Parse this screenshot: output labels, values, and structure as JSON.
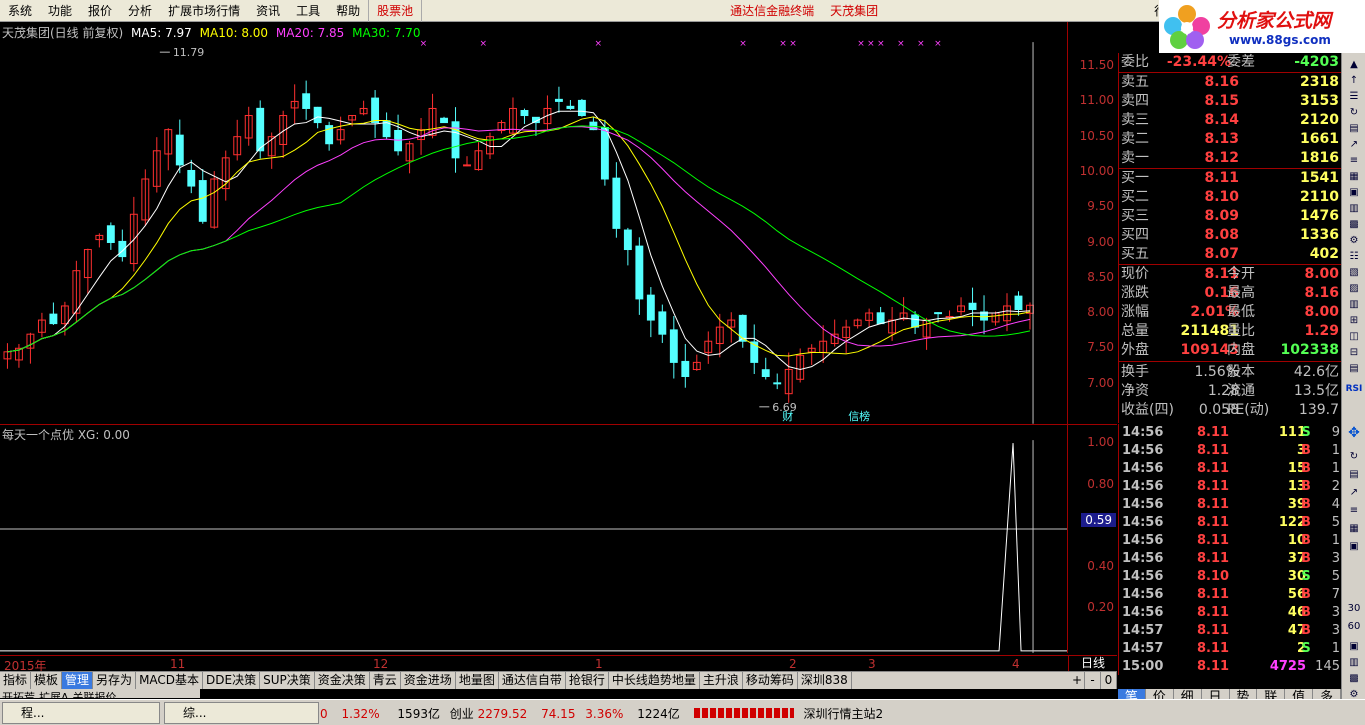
{
  "menu": {
    "items": [
      "系统",
      "功能",
      "报价",
      "分析",
      "扩展市场行情",
      "资讯",
      "工具",
      "帮助"
    ],
    "stock_pool": "股票池",
    "center_title": "通达信金融终端",
    "stock_name": "天茂集团",
    "corner_label": "行"
  },
  "promo": {
    "site_name": "分析家公式网",
    "url": "www.88gs.com"
  },
  "chart_title": {
    "name": "天茂集团(日线 前复权)",
    "ma5": "MA5: 7.97",
    "ma10": "MA10: 8.00",
    "ma20": "MA20: 7.85",
    "ma30": "MA30: 7.70"
  },
  "indicator_title": "每天一个点优  XG: 0.00",
  "indicator_axis": [
    "1.00",
    "0.80",
    "0.59",
    "0.40",
    "0.20"
  ],
  "price_axis": [
    "11.50",
    "11.00",
    "10.50",
    "10.00",
    "9.50",
    "9.00",
    "8.50",
    "8.00",
    "7.50",
    "7.00"
  ],
  "date_axis": [
    "2015年",
    "11",
    "12",
    "1",
    "2",
    "3",
    "4"
  ],
  "date_axis_right": "日线",
  "annotations": {
    "high": "11.79",
    "low": "6.69",
    "cai": "财",
    "xinbang": "信榜"
  },
  "tabs": [
    "指标",
    "模板",
    "管理",
    "另存为",
    "MACD基本",
    "DDE决策",
    "SUP决策",
    "资金决策",
    "青云",
    "资金进场",
    "地量图",
    "通达信自带",
    "抢银行",
    "中长线趋势地量",
    "主升浪",
    "移动筹码",
    "深圳838"
  ],
  "tabs_active": 2,
  "tabs_controls": [
    "+",
    "-",
    "0"
  ],
  "tabs_row2": [
    "开拓荒",
    "扩展A",
    "关联报价"
  ],
  "quote": {
    "weibi_label": "委比",
    "weibi": "-23.44%",
    "weicha_label": "委差",
    "weicha": "-4203",
    "asks": [
      {
        "label": "卖五",
        "price": "8.16",
        "vol": "2318"
      },
      {
        "label": "卖四",
        "price": "8.15",
        "vol": "3153"
      },
      {
        "label": "卖三",
        "price": "8.14",
        "vol": "2120"
      },
      {
        "label": "卖二",
        "price": "8.13",
        "vol": "1661"
      },
      {
        "label": "卖一",
        "price": "8.12",
        "vol": "1816"
      }
    ],
    "bids": [
      {
        "label": "买一",
        "price": "8.11",
        "vol": "1541"
      },
      {
        "label": "买二",
        "price": "8.10",
        "vol": "2110"
      },
      {
        "label": "买三",
        "price": "8.09",
        "vol": "1476"
      },
      {
        "label": "买四",
        "price": "8.08",
        "vol": "1336"
      },
      {
        "label": "买五",
        "price": "8.07",
        "vol": "402"
      }
    ],
    "stats": [
      {
        "l1": "现价",
        "v1": "8.11",
        "l2": "今开",
        "v2": "8.00"
      },
      {
        "l1": "涨跌",
        "v1": "0.16",
        "l2": "最高",
        "v2": "8.16"
      },
      {
        "l1": "涨幅",
        "v1": "2.01%",
        "l2": "最低",
        "v2": "8.00"
      },
      {
        "l1": "总量",
        "v1": "211481",
        "l2": "量比",
        "v2": "1.29"
      },
      {
        "l1": "外盘",
        "v1": "109143",
        "l2": "内盘",
        "v2": "102338"
      }
    ],
    "fund": [
      {
        "l1": "换手",
        "v1": "1.56%",
        "l2": "股本",
        "v2": "42.6亿"
      },
      {
        "l1": "净资",
        "v1": "1.28",
        "l2": "流通",
        "v2": "13.5亿"
      },
      {
        "l1": "收益(四)",
        "v1": "0.058",
        "l2": "PE(动)",
        "v2": "139.7"
      }
    ]
  },
  "ticks": [
    {
      "t": "14:56",
      "p": "8.11",
      "v": "111",
      "bs": "S",
      "n": "9"
    },
    {
      "t": "14:56",
      "p": "8.11",
      "v": "3",
      "bs": "B",
      "n": "1"
    },
    {
      "t": "14:56",
      "p": "8.11",
      "v": "15",
      "bs": "B",
      "n": "1"
    },
    {
      "t": "14:56",
      "p": "8.11",
      "v": "13",
      "bs": "B",
      "n": "2"
    },
    {
      "t": "14:56",
      "p": "8.11",
      "v": "39",
      "bs": "B",
      "n": "4"
    },
    {
      "t": "14:56",
      "p": "8.11",
      "v": "122",
      "bs": "B",
      "n": "5"
    },
    {
      "t": "14:56",
      "p": "8.11",
      "v": "10",
      "bs": "B",
      "n": "1"
    },
    {
      "t": "14:56",
      "p": "8.11",
      "v": "37",
      "bs": "B",
      "n": "3"
    },
    {
      "t": "14:56",
      "p": "8.10",
      "v": "30",
      "bs": "S",
      "n": "5"
    },
    {
      "t": "14:56",
      "p": "8.11",
      "v": "56",
      "bs": "B",
      "n": "7"
    },
    {
      "t": "14:56",
      "p": "8.11",
      "v": "46",
      "bs": "B",
      "n": "3"
    },
    {
      "t": "14:57",
      "p": "8.11",
      "v": "47",
      "bs": "B",
      "n": "3"
    },
    {
      "t": "14:57",
      "p": "8.11",
      "v": "2",
      "bs": "S",
      "n": "1"
    },
    {
      "t": "15:00",
      "p": "8.11",
      "v": "4725",
      "bs": "",
      "n": "145"
    }
  ],
  "right_tabs": [
    "笔",
    "价",
    "细",
    "日",
    "势",
    "联",
    "值",
    "多"
  ],
  "right_tabs_active": 0,
  "tools": [
    "RSI",
    "30",
    "60"
  ],
  "taskbar": {
    "task1": "程...",
    "task2": "综...",
    "status_a": "0",
    "status_b": "1.32%",
    "status_c": "1593亿",
    "status_d": "创业",
    "status_e": "2279.52",
    "status_f": "74.15",
    "status_g": "3.36%",
    "status_h": "1224亿",
    "server": "深圳行情主站2"
  },
  "colors": {
    "up": "#ff3030",
    "down": "#54ffff",
    "ma5": "#ffffff",
    "ma10": "#ffff00",
    "ma20": "#ff40ff",
    "ma30": "#00ff00"
  }
}
